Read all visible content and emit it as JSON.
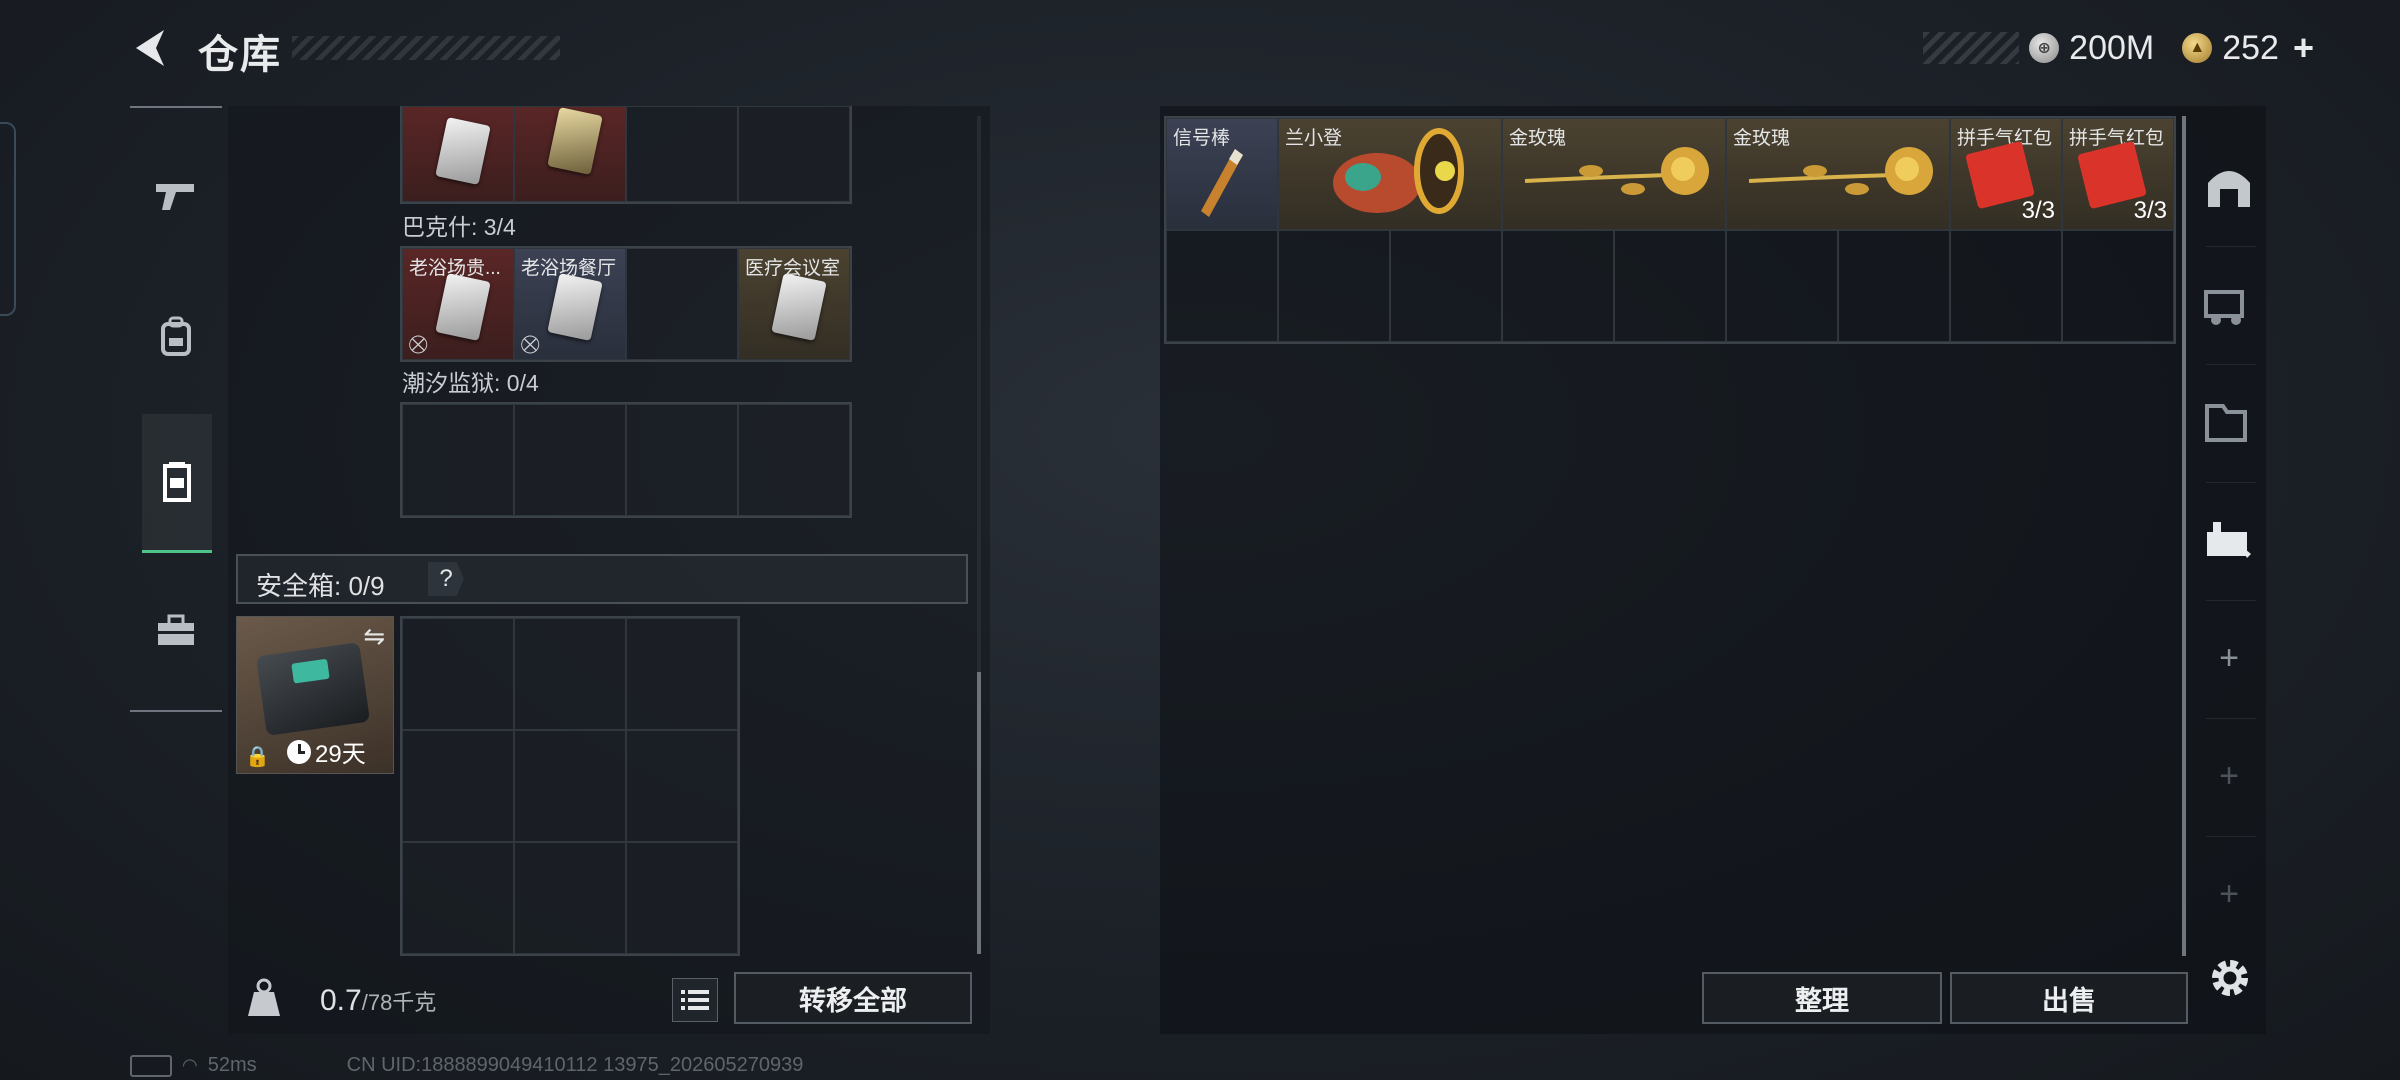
{
  "header": {
    "title": "仓库",
    "currencies": [
      {
        "icon": "silver-coin-icon",
        "value": "200M"
      },
      {
        "icon": "gold-coin-icon",
        "value": "252"
      }
    ],
    "add_label": "+"
  },
  "left_nav": {
    "items": [
      {
        "icon": "gun-icon"
      },
      {
        "icon": "backpack-icon"
      },
      {
        "icon": "container-icon",
        "active": true
      },
      {
        "icon": "toolbox-icon"
      }
    ]
  },
  "containers": {
    "bakeshi": {
      "caption": "巴克什: 3/4",
      "items": [
        {
          "label": "",
          "color": "red"
        },
        {
          "label": "",
          "color": "red"
        },
        {
          "label": ""
        },
        {
          "label": ""
        }
      ]
    },
    "row2": {
      "items": [
        {
          "label": "老浴场贵...",
          "unlinked": true
        },
        {
          "label": "老浴场餐厅",
          "unlinked": true
        },
        {
          "label": ""
        },
        {
          "label": "医疗会议室"
        }
      ],
      "unlinked_glyph": "⛒"
    },
    "chaoxi": {
      "caption": "潮汐监狱: 0/4"
    }
  },
  "safe": {
    "label": "安全箱: 0/9",
    "help": "?",
    "days": "29天",
    "swap_glyph": "⇋",
    "lock_glyph": "🔒"
  },
  "bottom_bar": {
    "weight_value": "0.7",
    "weight_capacity": "/78千克",
    "transfer_all": "转移全部"
  },
  "stash": {
    "items": [
      {
        "label": "信号棒"
      },
      {
        "label": "兰小登"
      },
      {
        "label": "金玫瑰"
      },
      {
        "label": "金玫瑰"
      },
      {
        "label": "拼手气红包",
        "count": "3/3"
      },
      {
        "label": "拼手气红包",
        "count": "3/3"
      }
    ],
    "sort": "整理",
    "sell": "出售"
  },
  "right_sidebar": {
    "plus": "+"
  },
  "footer": {
    "ping": "52ms",
    "uid": "CN UID:1888899049410112 13975_202605270939"
  }
}
